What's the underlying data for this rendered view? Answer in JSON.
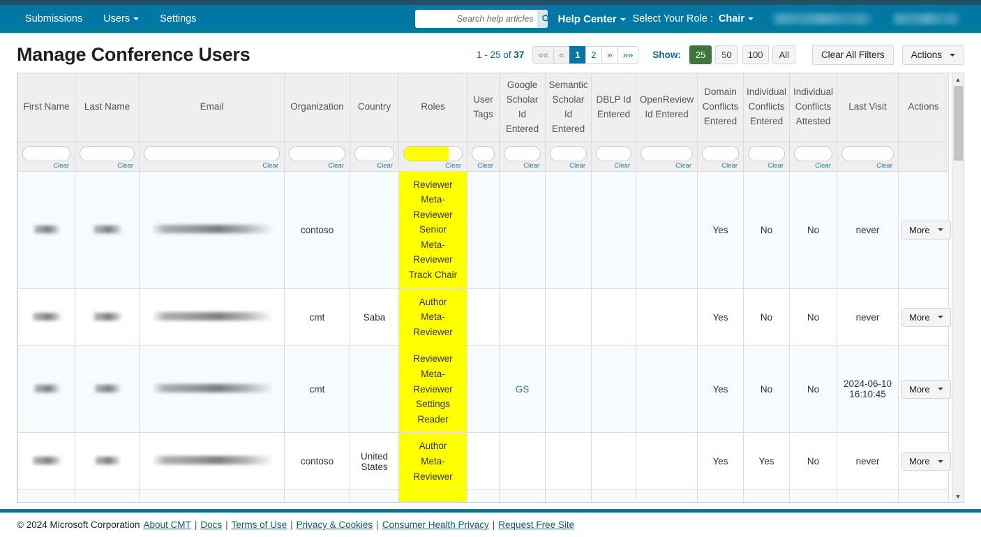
{
  "navbar": {
    "items": [
      {
        "label": "Submissions",
        "caret": false
      },
      {
        "label": "Users",
        "caret": true
      },
      {
        "label": "Settings",
        "caret": false
      }
    ],
    "search": {
      "placeholder": "Search help articles",
      "value": "",
      "icon": "search-icon"
    },
    "help_center": "Help Center",
    "role_prompt": "Select Your Role :",
    "role_selected": "Chair",
    "redacted_items": [
      "",
      ""
    ],
    "bg_color": "#0078a3",
    "top_strip_color": "#2b4a66"
  },
  "header": {
    "title": "Manage Conference Users",
    "range_text": "1 - 25 of ",
    "range_total": "37",
    "pager": [
      {
        "label": "««",
        "state": "muted",
        "name": "first-page"
      },
      {
        "label": "«",
        "state": "muted",
        "name": "prev-page"
      },
      {
        "label": "1",
        "state": "active",
        "name": "page-1"
      },
      {
        "label": "2",
        "state": "normal",
        "name": "page-2"
      },
      {
        "label": "»",
        "state": "normal",
        "name": "next-page"
      },
      {
        "label": "»»",
        "state": "normal",
        "name": "last-page"
      }
    ],
    "show_label": "Show:",
    "show_options": [
      {
        "label": "25",
        "selected": true
      },
      {
        "label": "50",
        "selected": false
      },
      {
        "label": "100",
        "selected": false
      },
      {
        "label": "All",
        "selected": false
      }
    ],
    "clear_all_filters": "Clear All Filters",
    "actions": "Actions",
    "selected_page_color": "#0a75a0",
    "selected_show_color": "#3c763d"
  },
  "table": {
    "columns": [
      "First Name",
      "Last Name",
      "Email",
      "Organization",
      "Country",
      "Roles",
      "User Tags",
      "Google Scholar Id Entered",
      "Semantic Scholar Id Entered",
      "DBLP Id Entered",
      "OpenReview Id Entered",
      "Domain Conflicts Entered",
      "Individual Conflicts Entered",
      "Individual Conflicts Attested",
      "Last Visit",
      "Actions"
    ],
    "filter_clear_label": "Clear",
    "filter_values": [
      "",
      "",
      "",
      "",
      "",
      "",
      "",
      "",
      "",
      "",
      "",
      "",
      "",
      "",
      ""
    ],
    "roles_filter_highlight": "#ffff00",
    "rows": [
      {
        "first_name": "",
        "last_name": "",
        "email": "",
        "organization": "contoso",
        "country": "",
        "roles": [
          "Reviewer",
          "Meta-",
          "Reviewer",
          "Senior",
          "Meta-",
          "Reviewer",
          "Track Chair"
        ],
        "user_tags": "",
        "google_scholar": "",
        "semantic_scholar": "",
        "dblp": "",
        "openreview": "",
        "domain_conflicts": "Yes",
        "individual_conflicts": "No",
        "conflicts_attested": "No",
        "last_visit": "never",
        "action_label": "More"
      },
      {
        "first_name": "",
        "last_name": "",
        "email": "",
        "organization": "cmt",
        "country": "Saba",
        "roles": [
          "Author",
          "Meta-",
          "Reviewer"
        ],
        "user_tags": "",
        "google_scholar": "",
        "semantic_scholar": "",
        "dblp": "",
        "openreview": "",
        "domain_conflicts": "Yes",
        "individual_conflicts": "No",
        "conflicts_attested": "No",
        "last_visit": "never",
        "action_label": "More"
      },
      {
        "first_name": "",
        "last_name": "",
        "email": "",
        "organization": "cmt",
        "country": "",
        "roles": [
          "Reviewer",
          "Meta-",
          "Reviewer",
          "Settings",
          "Reader"
        ],
        "user_tags": "",
        "google_scholar": "GS",
        "semantic_scholar": "",
        "dblp": "",
        "openreview": "",
        "domain_conflicts": "Yes",
        "individual_conflicts": "No",
        "conflicts_attested": "No",
        "last_visit": "2024-06-10 16:10:45",
        "action_label": "More"
      },
      {
        "first_name": "",
        "last_name": "",
        "email": "",
        "organization": "contoso",
        "country": "United States",
        "roles": [
          "Author",
          "Meta-",
          "Reviewer"
        ],
        "user_tags": "",
        "google_scholar": "",
        "semantic_scholar": "",
        "dblp": "",
        "openreview": "",
        "domain_conflicts": "Yes",
        "individual_conflicts": "Yes",
        "conflicts_attested": "No",
        "last_visit": "never",
        "action_label": "More"
      }
    ]
  },
  "footer": {
    "copyright": "© 2024 Microsoft Corporation",
    "links": [
      "About CMT",
      "Docs",
      "Terms of Use",
      "Privacy & Cookies",
      "Consumer Health Privacy",
      "Request Free Site"
    ],
    "separator": "|"
  }
}
